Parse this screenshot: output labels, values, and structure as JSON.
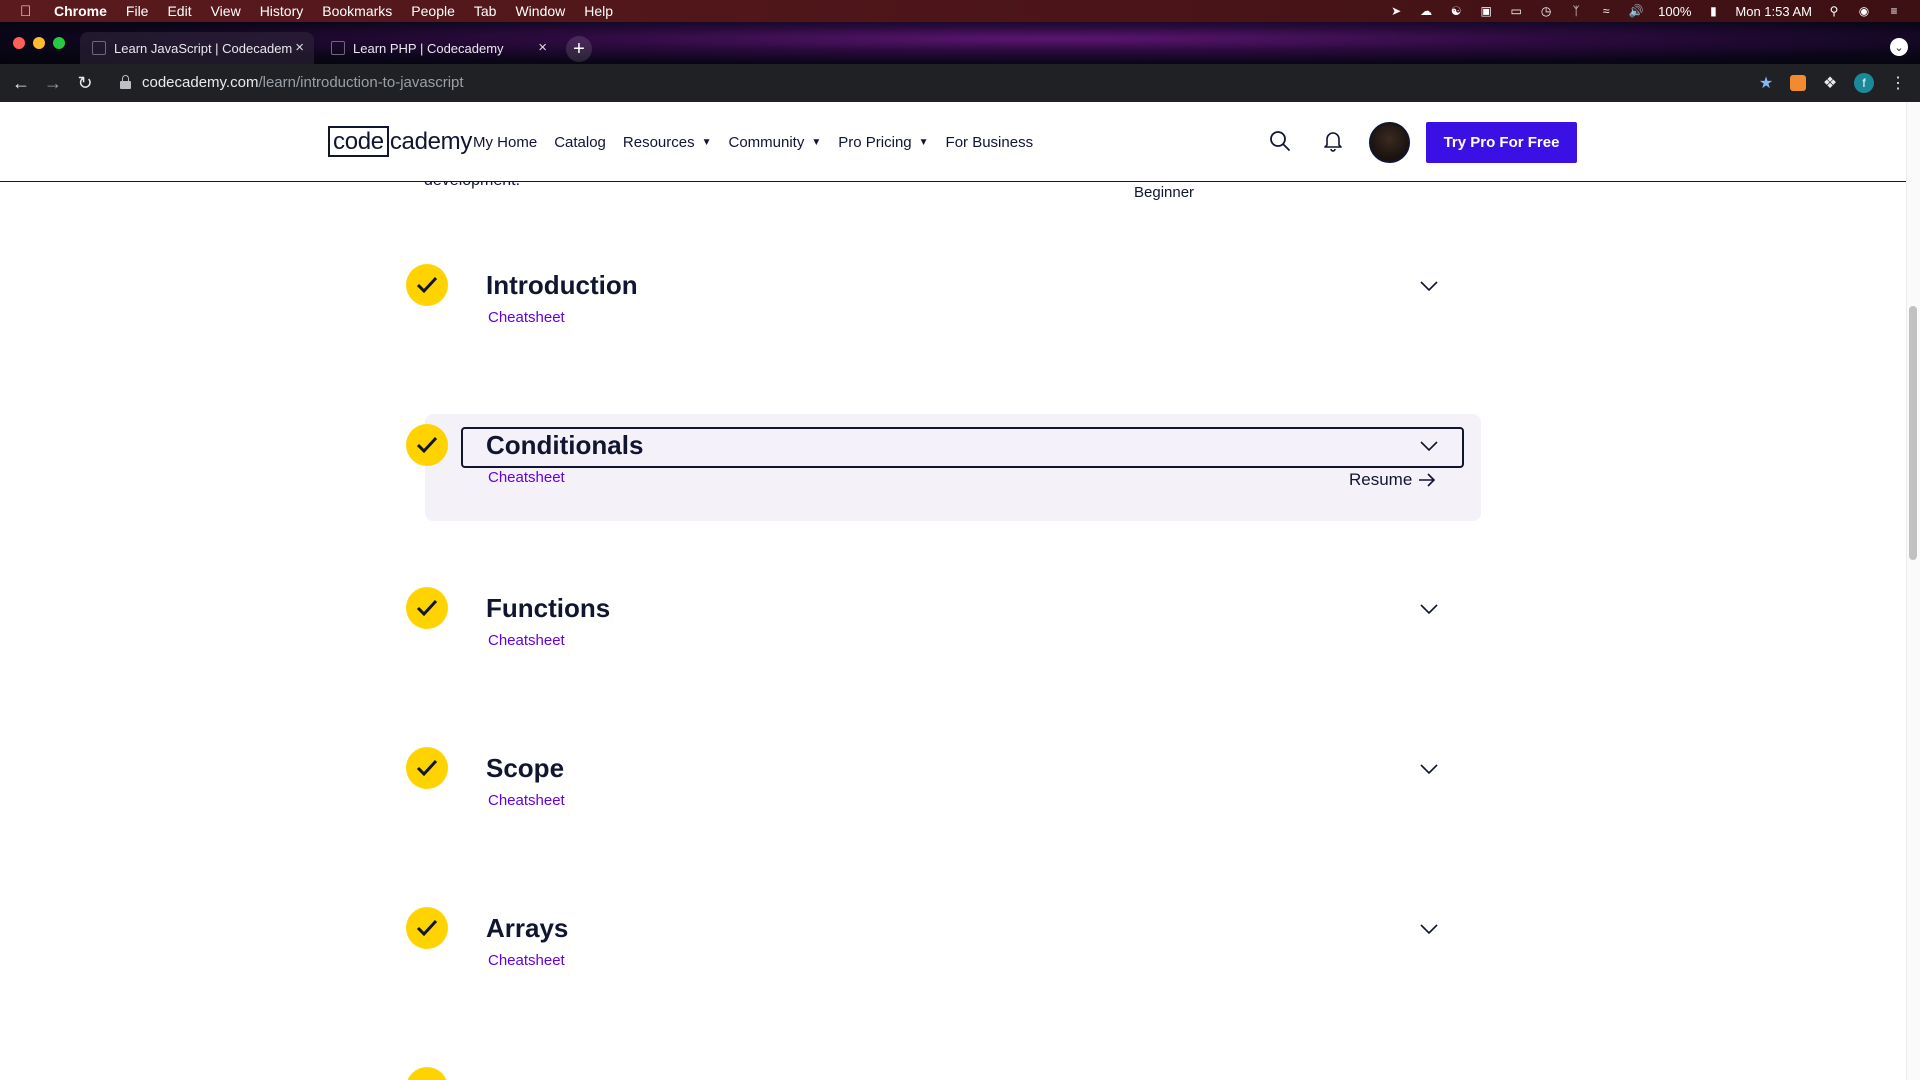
{
  "os_menubar": {
    "app": "Chrome",
    "menus": [
      "File",
      "Edit",
      "View",
      "History",
      "Bookmarks",
      "People",
      "Tab",
      "Window",
      "Help"
    ],
    "battery": "100%",
    "clock": "Mon 1:53 AM"
  },
  "browser": {
    "tabs": [
      {
        "title": "Learn JavaScript | Codecadem",
        "active": true
      },
      {
        "title": "Learn PHP | Codecademy",
        "active": false
      }
    ],
    "url_domain": "codecademy.com",
    "url_path": "/learn/introduction-to-javascript",
    "profile_initial": "f"
  },
  "site": {
    "logo_boxed": "code",
    "logo_rest": "cademy",
    "nav": [
      {
        "label": "My Home",
        "dropdown": false
      },
      {
        "label": "Catalog",
        "dropdown": false
      },
      {
        "label": "Resources",
        "dropdown": true
      },
      {
        "label": "Community",
        "dropdown": true
      },
      {
        "label": "Pro Pricing",
        "dropdown": true
      },
      {
        "label": "For Business",
        "dropdown": false
      }
    ],
    "cta_label": "Try Pro For Free",
    "accent": "#3a10e5",
    "check_color": "#ffd300",
    "link_color": "#6400e4"
  },
  "course": {
    "partial_description": "development.",
    "level": "Beginner",
    "modules": [
      {
        "title": "Introduction",
        "link": "Cheatsheet",
        "completed": true
      },
      {
        "title": "Conditionals",
        "link": "Cheatsheet",
        "completed": true,
        "resume": "Resume"
      },
      {
        "title": "Functions",
        "link": "Cheatsheet",
        "completed": true
      },
      {
        "title": "Scope",
        "link": "Cheatsheet",
        "completed": true
      },
      {
        "title": "Arrays",
        "link": "Cheatsheet",
        "completed": true
      }
    ]
  }
}
